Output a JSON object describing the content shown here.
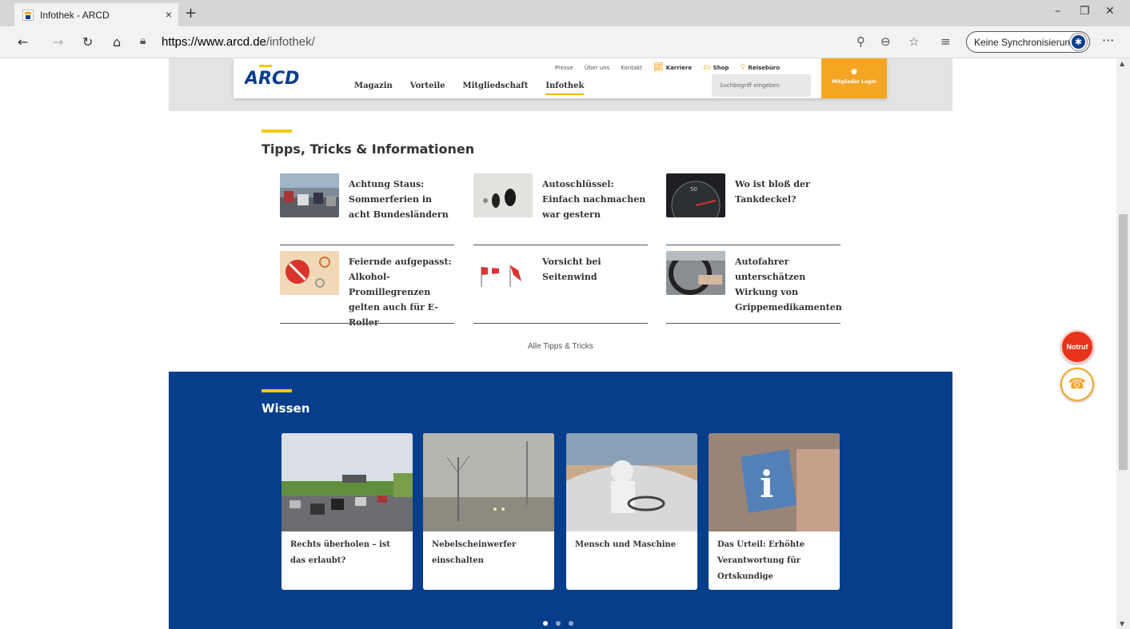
{
  "browser": {
    "tab_title": "Infothek - ARCD",
    "tab_close": "×",
    "new_tab": "+",
    "url_host": "https://www.arcd.de",
    "url_path": "/infothek/",
    "sync_label": "Keine Synchronisierung",
    "more": "···",
    "window_minimize": "–",
    "window_restore": "❐",
    "window_close": "✕"
  },
  "site": {
    "logo_text": "ARCD",
    "main_nav": [
      "Magazin",
      "Vorteile",
      "Mitgliedschaft",
      "Infothek"
    ],
    "meta_nav": {
      "presse": "Presse",
      "ueber_uns": "Über uns",
      "kontakt": "Kontakt",
      "karriere": "Karriere",
      "shop": "Shop",
      "reisebuero": "Reisebüro"
    },
    "search_placeholder": "Suchbegriff eingeben",
    "login_label": "Mitglieder Login"
  },
  "tipps": {
    "title": "Tipps, Tricks & Informationen",
    "items": [
      {
        "text": "Achtung Staus: Sommerferien in acht Bundesländern"
      },
      {
        "text": "Autoschlüssel: Einfach nachmachen war gestern"
      },
      {
        "text": "Wo ist bloß der Tankdeckel?"
      },
      {
        "text": "Feiernde aufgepasst: Alkohol-Promillegrenzen gelten auch für E-Roller"
      },
      {
        "text": "Vorsicht bei Seitenwind"
      },
      {
        "text": "Autofahrer unterschätzen Wirkung von Grippemedikamenten"
      }
    ],
    "all_link": "Alle Tipps & Tricks"
  },
  "wissen": {
    "title": "Wissen",
    "cards": [
      {
        "text": "Rechts überholen – ist das erlaubt?"
      },
      {
        "text": "Nebelscheinwerfer einschalten"
      },
      {
        "text": "Mensch und Maschine"
      },
      {
        "text": "Das Urteil: Erhöhte Verantwortung für Ortskundige"
      }
    ],
    "carousel_pages": 3,
    "carousel_active": 1
  },
  "floating": {
    "notruf": "Notruf"
  },
  "colors": {
    "brand_blue": "#063e8c",
    "brand_yellow": "#f5c900",
    "login_orange": "#f5a524",
    "notruf_red": "#e8331c"
  }
}
